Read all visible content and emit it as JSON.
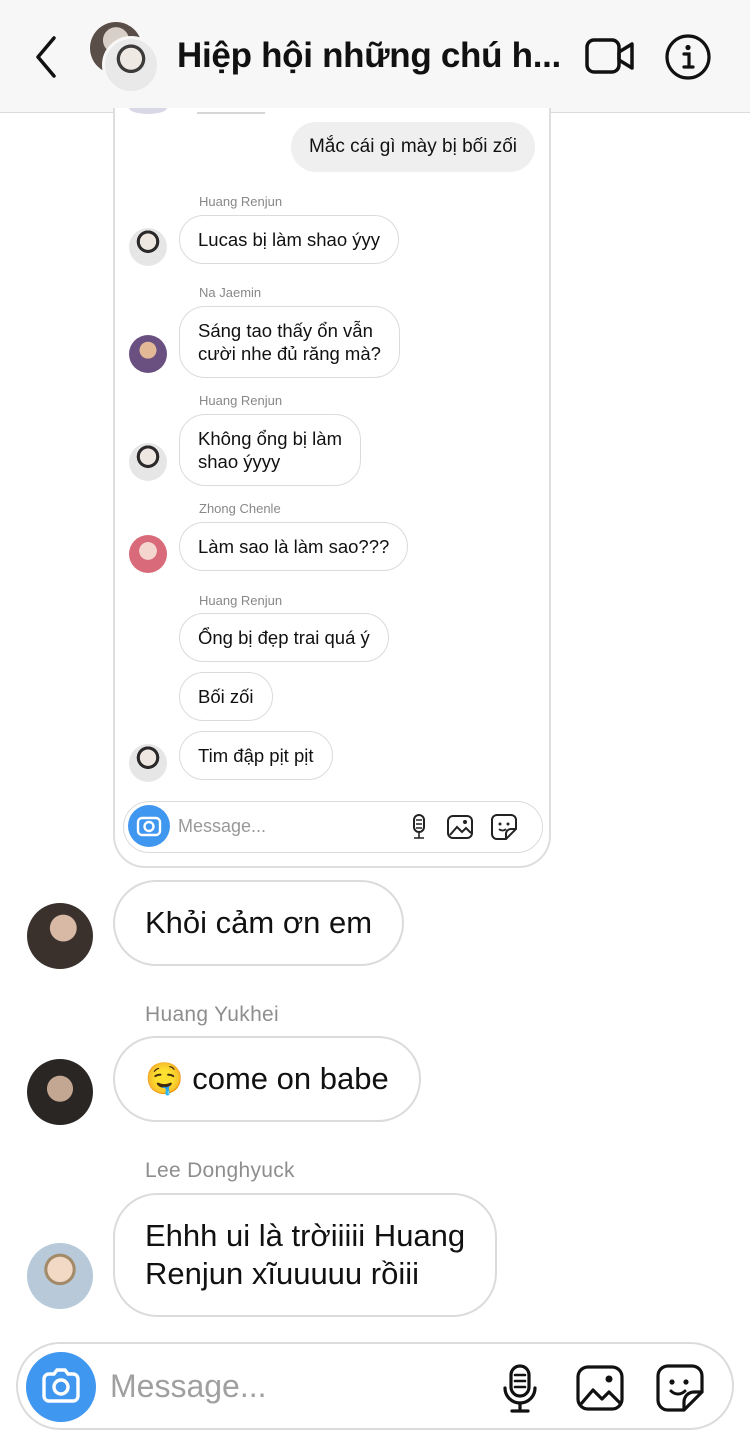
{
  "header": {
    "title": "Hiệp hội những chú h...",
    "icons": [
      "back-icon",
      "video-call-icon",
      "info-icon"
    ]
  },
  "embedded": {
    "sent_message": "Mắc cái gì mày bị bối zối",
    "messages": [
      {
        "sender": "Huang Renjun",
        "lines": [
          "Lucas bị làm shao ýyy"
        ]
      },
      {
        "sender": "Na Jaemin",
        "lines": [
          "Sáng tao thấy ổn vẫn",
          "cười nhe đủ răng mà?"
        ]
      },
      {
        "sender": "Huang Renjun",
        "lines": [
          "Không ổng bị làm",
          "shao ýyyy"
        ]
      },
      {
        "sender": "Zhong Chenle",
        "lines": [
          "Làm sao là làm sao???"
        ]
      },
      {
        "sender": "Huang Renjun",
        "lines": [
          "Ổng bị đẹp trai quá ý",
          "Bối zối",
          "Tim đập pịt pịt"
        ]
      }
    ],
    "input_placeholder": "Message..."
  },
  "thread": [
    {
      "sender": "",
      "text": "Khỏi cảm ơn em"
    },
    {
      "sender": "Huang Yukhei",
      "text": "🤤 come on babe"
    },
    {
      "sender": "Lee Donghyuck",
      "text": "Ehhh ui là trờiiiii Huang",
      "text2": "Renjun xĩuuuuu rồiii"
    }
  ],
  "composer": {
    "placeholder": "Message...",
    "icons": [
      "camera-icon",
      "microphone-icon",
      "gallery-icon",
      "sticker-icon"
    ]
  },
  "colors": {
    "accent": "#3f97f0",
    "bubble_border": "#dbdbdb",
    "sent_bubble": "#efefef",
    "muted_text": "#8e8e8e"
  }
}
